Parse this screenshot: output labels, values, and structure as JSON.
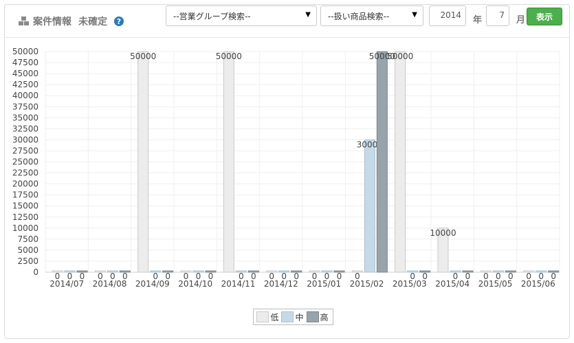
{
  "header": {
    "title": "案件情報",
    "status": "未確定",
    "help_icon": "?",
    "group_select": "--営業グループ検索--",
    "product_select": "--扱い商品検索--",
    "year": "2014",
    "year_unit": "年",
    "month": "7",
    "month_unit": "月",
    "show_button": "表示"
  },
  "chart_data": {
    "type": "bar",
    "categories": [
      "2014/07",
      "2014/08",
      "2014/09",
      "2014/10",
      "2014/11",
      "2014/12",
      "2015/01",
      "2015/02",
      "2015/03",
      "2015/04",
      "2015/05",
      "2015/06"
    ],
    "series": [
      {
        "name": "低",
        "color": "#ececec",
        "stroke": "#c9c9c9",
        "values": [
          0,
          0,
          50000,
          0,
          50000,
          0,
          0,
          0,
          50000,
          10000,
          0,
          0
        ]
      },
      {
        "name": "中",
        "color": "#c6d9e6",
        "stroke": "#a9c1d3",
        "values": [
          0,
          0,
          0,
          0,
          0,
          0,
          0,
          30000,
          0,
          0,
          0,
          0
        ]
      },
      {
        "name": "高",
        "color": "#98a4ab",
        "stroke": "#7b878e",
        "values": [
          0,
          0,
          0,
          0,
          0,
          0,
          0,
          50000,
          0,
          0,
          0,
          0
        ]
      }
    ],
    "ylim": [
      0,
      50000
    ],
    "yticks": [
      0,
      2500,
      5000,
      7500,
      10000,
      12500,
      15000,
      17500,
      20000,
      22500,
      25000,
      27500,
      30000,
      32500,
      35000,
      37500,
      40000,
      42500,
      45000,
      47500,
      50000
    ],
    "grid": true,
    "legend_position": "bottom-center"
  }
}
